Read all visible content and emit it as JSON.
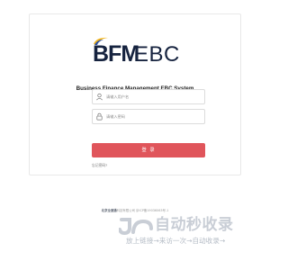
{
  "brand": {
    "logo_bfm": "BFM",
    "logo_ebc": "EBC",
    "system_title": "Business Finance Management EBC System"
  },
  "login": {
    "username_placeholder": "请输入用户名",
    "password_placeholder": "请输入密码",
    "submit_label": "登 录",
    "forgot_label": "忘记密码?"
  },
  "footer": {
    "company": "北京全速通",
    "rest": "科技有限公司 京ICP备19036063号-1"
  },
  "watermark": {
    "main": "自动秒收录",
    "sub": "放上链接→来访一次→自动收录→"
  },
  "colors": {
    "primary_button": "#e0555b",
    "brand_navy": "#16233f",
    "brand_gold": "#f2b51d"
  },
  "icons": {
    "username": "user-icon",
    "password": "lock-icon"
  }
}
